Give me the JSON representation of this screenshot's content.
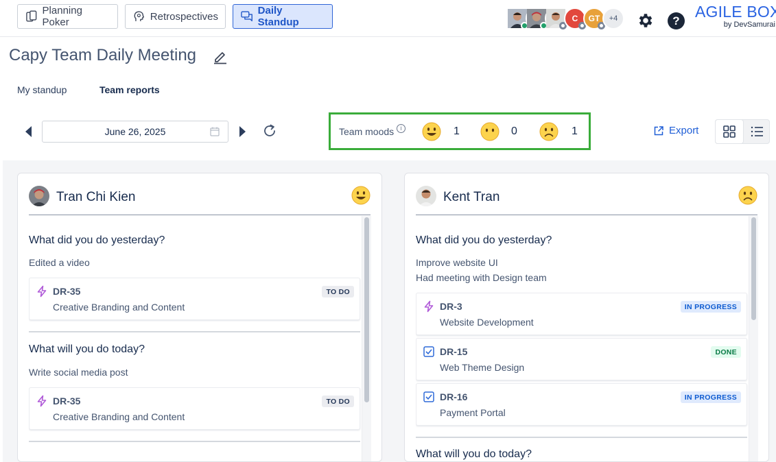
{
  "nav": {
    "planning_poker": "Planning Poker",
    "retrospectives": "Retrospectives",
    "daily_standup": "Daily Standup"
  },
  "participants": {
    "initials_c": "C",
    "initials_gt": "GT",
    "more": "+4"
  },
  "help_label": "?",
  "brand": {
    "name": "AGILE BOX",
    "sub": "by DevSamurai"
  },
  "page": {
    "title": "Capy Team Daily Meeting"
  },
  "tabs": {
    "my_standup": "My standup",
    "team_reports": "Team reports"
  },
  "toolbar": {
    "date": "June 26, 2025",
    "export": "Export"
  },
  "moods": {
    "label": "Team moods",
    "info": "i",
    "happy": "1",
    "neutral": "0",
    "sad": "1"
  },
  "cards": {
    "left": {
      "name": "Tran Chi Kien",
      "mood": "happy",
      "q1": "What did you do yesterday?",
      "a1": "Edited a video",
      "i1_key": "DR-35",
      "i1_title": "Creative Branding and Content",
      "i1_status": "TO DO",
      "q2": "What will you do today?",
      "a2": "Write social media post",
      "i2_key": "DR-35",
      "i2_title": "Creative Branding and Content",
      "i2_status": "TO DO"
    },
    "right": {
      "name": "Kent Tran",
      "mood": "sad",
      "q1": "What did you do yesterday?",
      "a1": "Improve website UI",
      "a1b": "Had meeting with Design team",
      "i1_key": "DR-3",
      "i1_title": "Website Development",
      "i1_status": "IN PROGRESS",
      "i2_key": "DR-15",
      "i2_title": "Web Theme Design",
      "i2_status": "DONE",
      "i3_key": "DR-16",
      "i3_title": "Payment Portal",
      "i3_status": "IN PROGRESS",
      "q2": "What will you do today?"
    }
  },
  "colors": {
    "accent": "#2a63e2",
    "moods_border": "#3aac3a",
    "online": "#22a06b"
  }
}
